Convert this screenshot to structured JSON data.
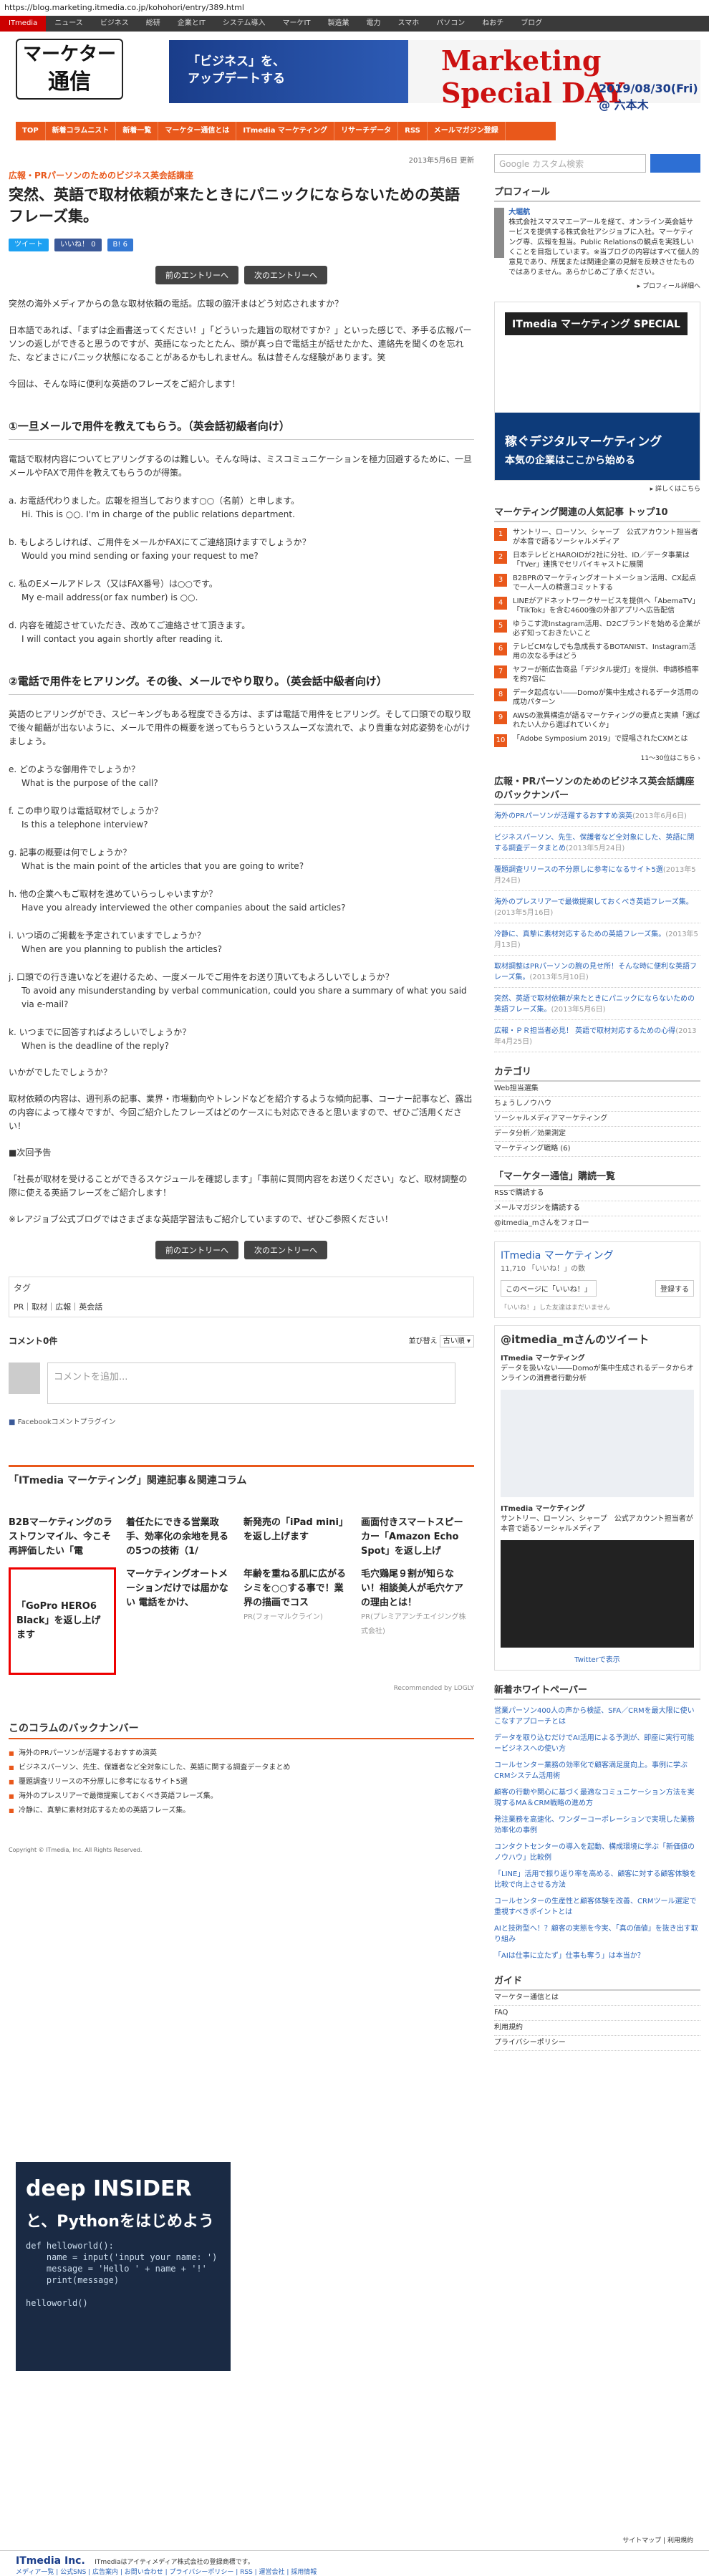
{
  "url": "https://blog.marketing.itmedia.co.jp/kohohori/entry/389.html",
  "topnav": [
    "ITmedia",
    "ニュース",
    "ビジネス",
    "総研",
    "企業とIT",
    "システム導入",
    "マーケIT",
    "製造業",
    "電力",
    "スマホ",
    "パソコン",
    "ねおチ",
    "ブログ"
  ],
  "logo": {
    "l1": "マーケター",
    "l2": "通信"
  },
  "banner": {
    "line1": "「ビジネス」を、",
    "line2": "アップデートする",
    "title": "Marketing Special DAY",
    "date": "2019/08/30(Fri) @ 六本木"
  },
  "catnav": [
    "TOP",
    "新着コラムニスト",
    "新着一覧",
    "マーケター通信とは",
    "ITmedia マーケティング",
    "リサーチデータ",
    "RSS",
    "メールマガジン登録"
  ],
  "article": {
    "date": "2013年5月6日 更新",
    "category": "広報・PRパーソンのためのビジネス英会話講座",
    "title": "突然、英語で取材依頼が来たときにパニックにならないための英語フレーズ集。",
    "tweet": "ツイート",
    "like": "いいね！ 0",
    "bookmark": "B! 6",
    "prev": "前のエントリーへ",
    "next": "次のエントリーへ",
    "intro1": "突然の海外メディアからの急な取材依頼の電話。広報の脇汗まはどう対応されますか？",
    "intro2": "日本語であれば、「まずは企画書送ってください！」「どういった趣旨の取材ですか？」といった感じで、矛手る広報パーソンの返しができると思うのですが、英語になったとたん、頭が真っ白で電話主が話せたかた、連絡先を聞くのを忘れた、などまさにパニック状態になることがあるかもしれません。私は昔そんな経験があります。笑",
    "intro3": "今回は、そんな時に便利な英語のフレーズをご紹介します！",
    "h2a": "①一旦メールで用件を教えてもらう。（英会話初級者向け）",
    "p_a": "電話で取材内容についてヒアリングするのは難しい。そんな時は、ミスコミュニケーションを極力回避するために、一旦メールやFAXで用件を教えてもらうのが得策。",
    "qa": [
      {
        "jp": "a. お電話代わりました。広報を担当しております○○（名前）と申します。",
        "en": "Hi. This is ○○. I'm in charge of the public relations department."
      },
      {
        "jp": "b. もしよろしければ、ご用件をメールかFAXにてご連絡頂けますでしょうか？",
        "en": "Would you mind sending or faxing your request to me?"
      },
      {
        "jp": "c. 私のEメールアドレス（又はFAX番号）は○○です。",
        "en": "My e-mail address(or fax number) is ○○."
      },
      {
        "jp": "d. 内容を確認させていただき、改めてご連絡させて頂きます。",
        "en": "I will contact you again shortly after reading it."
      }
    ],
    "h2b": "②電話で用件をヒアリング。その後、メールでやり取り。（英会話中級者向け）",
    "p_b": "英語のヒアリングができ、スピーキングもある程度できる方は、まずは電話で用件をヒアリング。そして口頭での取り取で後々齟齬が出ないように、メールで用件の概要を送ってもらうというスムーズな流れで、より貴重な対応姿勢を心がけましょう。",
    "qb": [
      {
        "jp": "e. どのような御用件でしょうか？",
        "en": "What is the purpose of the call?"
      },
      {
        "jp": "f. この申り取りは電話取材でしょうか？",
        "en": "Is this a telephone interview?"
      },
      {
        "jp": "g. 記事の概要は何でしょうか？",
        "en": "What is the main point of the articles that you are going to write?"
      },
      {
        "jp": "h. 他の企業へもご取材を進めていらっしゃいますか？",
        "en": "Have you already interviewed the other companies about the said articles?"
      },
      {
        "jp": "i. いつ頃のご掲載を予定されていますでしょうか？",
        "en": "When are you planning to publish the articles?"
      },
      {
        "jp": "j. 口頭での行き違いなどを避けるため、一度メールでご用件をお送り頂いてもよろしいでしょうか？",
        "en": "To avoid any misunderstanding by verbal communication, could you share a summary of what you said via e-mail?"
      },
      {
        "jp": "k. いつまでに回答すればよろしいでしょうか？",
        "en": "When is the deadline of the reply?"
      }
    ],
    "outro1": "いかがでしたでしょうか？",
    "outro2": "取材依頼の内容は、週刊系の記事、業界・市場動向やトレンドなどを紹介するような傾向記事、コーナー記事など、露出の内容によって様々ですが、今回ご紹介したフレーズはどのケースにも対応できると思いますので、ぜひご活用ください！",
    "next_head": "■次回予告",
    "next_text": "「社長が取材を受けることができるスケジュールを確認します」「事前に質問内容をお送りください」など、取材調整の際に使える英語フレーズをご紹介します！",
    "blog_note": "※レアジョブ公式ブログではさまざまな英語学習法もご紹介していますので、ぜひご参照ください！",
    "tags_label": "タグ",
    "tags": "PR｜取材｜広報｜英会話"
  },
  "comments": {
    "count": "コメント0件",
    "sort": "並び替え",
    "sort_val": "古い順 ▾",
    "placeholder": "コメントを追加...",
    "plugin": "Facebookコメントプラグイン"
  },
  "related": {
    "title": "「ITmedia マーケティング」関連記事＆関連コラム",
    "items": [
      {
        "t": "B2Bマーケティングのラストワンマイル、今こそ再評価したい「電",
        "pr": ""
      },
      {
        "t": "着任たにできる営業政手、効率化の余地を見るの5つの技術（1/",
        "pr": ""
      },
      {
        "t": "新発売の「iPad mini」を返し上げます",
        "pr": ""
      },
      {
        "t": "画面付きスマートスピーカー「Amazon Echo Spot」を返し上げ",
        "pr": ""
      },
      {
        "t": "「GoPro HERO6 Black」を返し上げます",
        "pr": ""
      },
      {
        "t": "マーケティングオートメーションだけでは届かない 電話をかけ、",
        "pr": ""
      },
      {
        "t": "年齢を重ねる肌に広がるシミを○○する事で！業界の描画でコス",
        "pr": "PR(フォーマルクライン)"
      },
      {
        "t": "毛穴鶏尾９割が知らない！相談美人が毛穴ケアの理由とは！",
        "pr": "PR(プレミアアンチエイジング株式会社)"
      }
    ],
    "recommended": "Recommended by LOGLY"
  },
  "backnumber": {
    "title": "このコラムのバックナンバー",
    "items": [
      "海外のPRパーソンが活躍するおすすめ演英",
      "ビジネスパーソン、先生、保護者など全対象にした、英語に関する調査データまとめ",
      "覆題調査リリースの不分原しに参考になるサイト5選",
      "海外のプレスリアーで最徴提案しておくべき英語フレーズ集。",
      "冷静に、真摯に素材対応するための英語フレーズ集。"
    ]
  },
  "copyright": "Copyright © ITmedia, Inc. All Rights Reserved.",
  "promo": {
    "brand": "deep INSIDER",
    "headline": "と、Pythonをはじめよう",
    "code": "def helloworld():\n    name = input('input your name: ')\n    message = 'Hello ' + name + '!'\n    print(message)\n\nhelloworld()"
  },
  "sidebar": {
    "search_placeholder": "Google カスタム検索",
    "profile_head": "プロフィール",
    "profile_name": "大堀航",
    "profile_text": "株式会社スマスマエーアールを経て、オンライン英会話サービスを提供する株式会社アシジョブに入社。マーケティング専、広報を担当。Public Relationsの観点を実践しいくことを目指しています。※当ブログの内容はすべて個人的意見であり、所属または関連企業の見解を反映させたものではありません。あらかじめご了承ください。",
    "profile_more": "▸ プロフィール詳細へ",
    "ad_logo": "ITmedia マーケティング SPECIAL",
    "ad_t1": "稼ぐデジタルマーケティング",
    "ad_t2": "本気の企業はここから始める",
    "ad_more": "▸ 詳しくはこちら",
    "rank_head": "マーケティング関連の人気記事 トップ10",
    "rank": [
      "サントリー、ローソン、シャープ　公式アカウント担当者が本音で語るソーシャルメディア",
      "日本テレビとHAROIDが2社に分社、ID／データ事業は「TVer」連携でセリバイキャストに展開",
      "B2BPRのマーケティングオートメーション活用、CX起点で一人一人の精選コミットする",
      "LINEがアドネットワークサービスを提供へ「AbemaTV」「TikTok」を含む4600強の外部アプリへ広告配信",
      "ゆうこす流Instagram活用、D2Cブランドを始める企業が必ず知っておきたいこと",
      "テレビCMなしでも急成長するBOTANIST、Instagram活用の次なる手はどう",
      "ヤフーが新広告商品「デジタル提灯」を提供、申請移植率を約7倍に",
      "データ起点ない――Domoが集中生成されるデータ活用の成功パターン",
      "AWSの激異構造が語るマーケティングの要点と実績「選ばれたい人から選ばれていくか」",
      "「Adobe Symposium 2019」で提唱されたCXMとは"
    ],
    "rank_more": "11〜30位はこちら ›",
    "cat_head": "広報・PRパーソンのためのビジネス英会話講座のバックナンバー",
    "cat_list": [
      {
        "t": "海外のPRパーソンが活躍するおすすめ演英",
        "d": "(2013年6月6日)"
      },
      {
        "t": "ビジネスパーソン、先生、保護者など全対象にした、英語に関する調査データまとめ",
        "d": "(2013年5月24日)"
      },
      {
        "t": "覆題調査リリースの不分原しに参考になるサイト5選",
        "d": "(2013年5月24日)"
      },
      {
        "t": "海外のプレスリアーで最徴提案しておくべき英語フレーズ集。",
        "d": "(2013年5月16日)"
      },
      {
        "t": "冷静に、真摯に素材対応するための英語フレーズ集。",
        "d": "(2013年5月13日)"
      },
      {
        "t": "取材調整はPRパーソンの腕の見せ所！そんな時に便利な英語フレーズ集。",
        "d": "(2013年5月10日)"
      },
      {
        "t": "突然、英語で取材依頼が来たときにパニックにならないための英語フレーズ集。",
        "d": "(2013年5月6日)"
      },
      {
        "t": "広報・ＰＲ担当者必見！ 英語で取材対応するための心得",
        "d": "(2013年4月25日)"
      }
    ],
    "category_head": "カテゴリ",
    "categories": [
      "Web担当選集",
      "ちょうしノウハウ",
      "ソーシャルメディアマーケティング",
      "データ分析／効果測定",
      "マーケティング戦略 (6)"
    ],
    "subscribe_head": "「マーケター通信」購読一覧",
    "subscribe": [
      "RSSで購読する",
      "メールマガジンを購読する",
      "@itmedia_mさんをフォロー"
    ],
    "fb_name": "ITmedia マーケティング",
    "fb_likes": "11,710 「いいね！」の数",
    "fb_share": "このページに「いいね！」",
    "fb_reg": "登録する",
    "fb_note": "「いいね！」した友達はまだいません",
    "tw_head": "@itmedia_mさんのツイート",
    "tw_name": "ITmedia マーケティング",
    "tw1": "データを扱いない――Domoが集中生成されるデータからオンラインの消費者行動分析",
    "tw2": "サントリー、ローソン、シャープ　公式アカウント担当者が本音で語るソーシャルメディア",
    "tw_link": "Twitterで表示",
    "wp_head": "新着ホワイトペーパー",
    "wp": [
      "営業パーソン400人の声から検証、SFA／CRMを最大限に使いこなすアプローチとは",
      "データを取り込むだけでAI活用による予測が、即座に実行可能ービジネスへの使い方",
      "コールセンター業務の効率化で顧客満足度向上。事例に学ぶCRMシステム活用術",
      "顧客の行動や関心に基づく最適なコミュニケーション方法を実現するMA＆CRM戦略の進め方",
      "発注業務を高速化、ワンダーコーポレーションで実現した業務効率化の事例",
      "コンタクトセンターの導入を起動、構成環境に学ぶ「新価値のノウハウ」比較例",
      "「LINE」活用で振り返り率を高める、顧客に対する顧客体験を比較で向上させる方法",
      "コールセンターの生産性と顧客体験を改善、CRMツール選定で重視すべきポイントとは",
      "AIと技術型へ！？顧客の実態を今実、「真の価値」を抜き出す取り組み",
      "「AIは仕事に立たず」仕事も奪う」は本当か？"
    ],
    "guide_head": "ガイド",
    "guide": [
      "マーケター通信とは",
      "FAQ",
      "利用規約",
      "プライバシーポリシー"
    ]
  },
  "footer": {
    "brand": "ITmedia Inc.",
    "desc": "ITmediaはアイティメディア株式会社の登録商標です。",
    "links": "メディア一覧 | 公式SNS | 広告案内 | お問い合わせ | プライバシーポリシー | RSS | 運営会社 | 採用情報",
    "sitemap": "サイトマップ | 利用規約"
  }
}
